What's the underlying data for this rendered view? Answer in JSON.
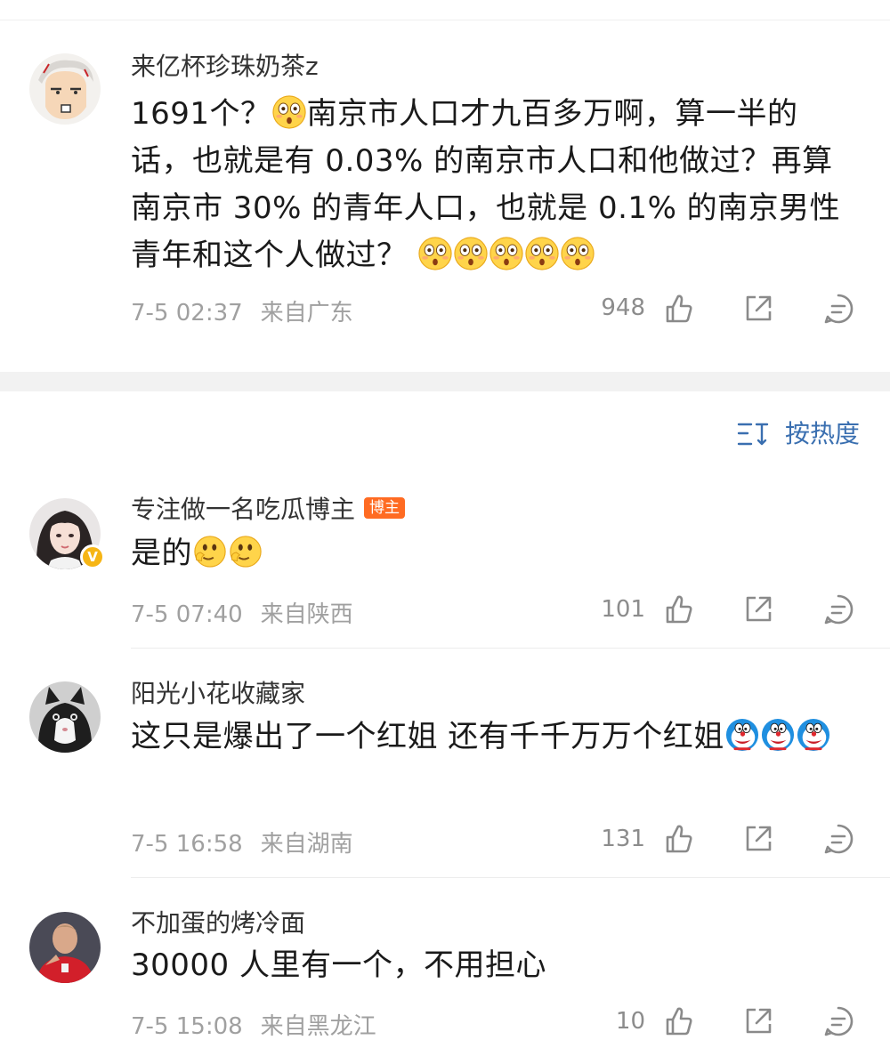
{
  "top_comment": {
    "username": "来亿杯珍珠奶茶z",
    "text_parts": [
      "1691个？",
      "南京市人口才九百多万啊，算一半的话，也就是有 0.03% 的南京市人口和他做过？再算南京市 30% 的青年人口，也就是 0.1% 的南京男性青年和这个人做过？"
    ],
    "emoji": "flushed-face",
    "time": "7-5 02:37",
    "location": "来自广东",
    "likes": "948"
  },
  "sort": {
    "label": "按热度",
    "icon": "sort-icon"
  },
  "comments": [
    {
      "username": "专注做一名吃瓜博主",
      "badge": "博主",
      "text": "是的",
      "emoji": "thinking-hand-face",
      "time": "7-5 07:40",
      "location": "来自陕西",
      "likes": "101"
    },
    {
      "username": "阳光小花收藏家",
      "text": "这只是爆出了一个红姐 还有千千万万个红姐",
      "emoji": "doraemon-face",
      "time": "7-5 16:58",
      "location": "来自湖南",
      "likes": "131"
    },
    {
      "username": "不加蛋的烤冷面",
      "text": "30000 人里有一个，不用担心",
      "time": "7-5 15:08",
      "location": "来自黑龙江",
      "likes": "10"
    }
  ],
  "icons": [
    "like-icon",
    "share-icon",
    "reply-icon"
  ],
  "colors": {
    "accent": "#3a6fb0",
    "badge": "#ff6b22",
    "meta": "#a0a0a0",
    "verified": "#f6b515"
  }
}
